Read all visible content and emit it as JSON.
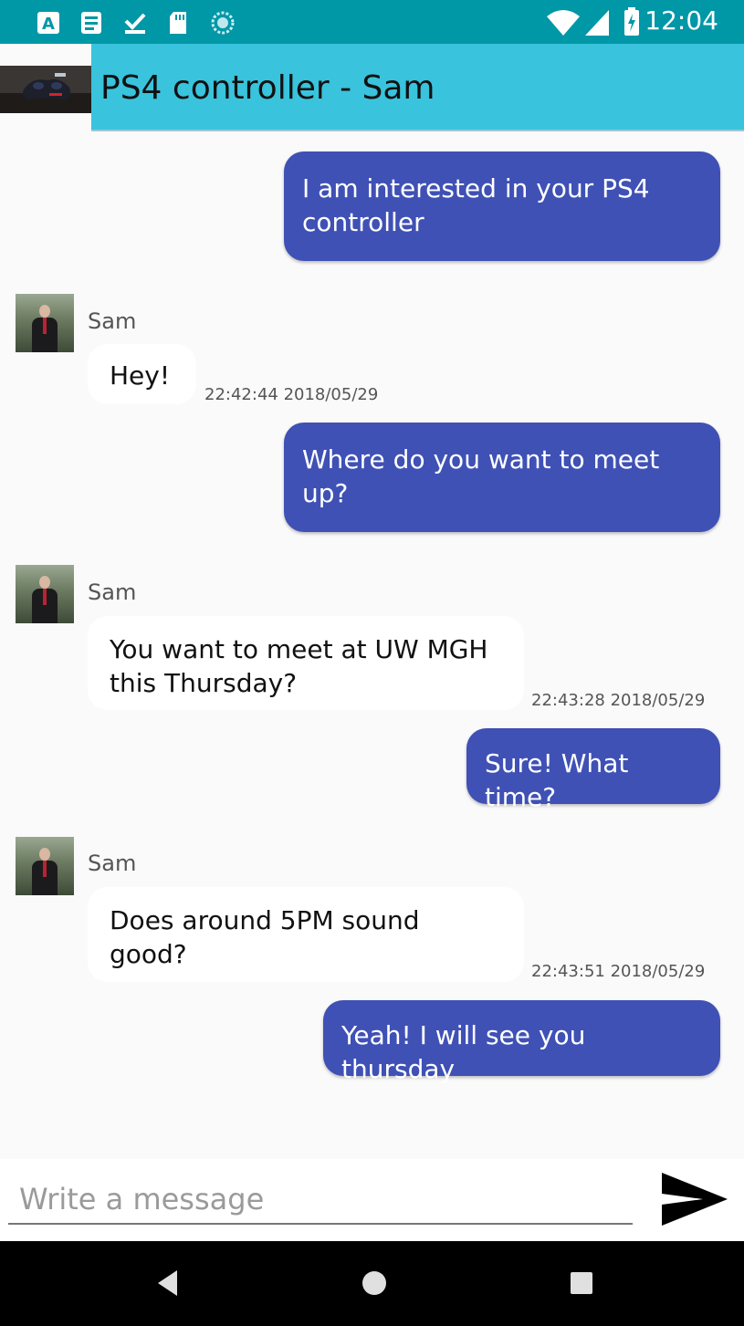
{
  "status_bar": {
    "time": "12:04",
    "left_icons": [
      "a-box-icon",
      "notes-icon",
      "checkmark-download-icon",
      "sd-card-icon",
      "sync-circle-icon"
    ],
    "right_icons": [
      "wifi-icon",
      "signal-icon",
      "battery-charging-icon"
    ]
  },
  "app_bar": {
    "title": "PS4 controller - Sam"
  },
  "messages": [
    {
      "type": "out",
      "text": "I am interested in your PS4 controller"
    },
    {
      "type": "in",
      "sender": "Sam",
      "text": "Hey!",
      "time": "22:42:44 2018/05/29"
    },
    {
      "type": "out",
      "text": "Where do you want to meet up?"
    },
    {
      "type": "in",
      "sender": "Sam",
      "text": "You want to meet at UW MGH this Thursday?",
      "time": "22:43:28 2018/05/29"
    },
    {
      "type": "out",
      "text": "Sure! What time?"
    },
    {
      "type": "in",
      "sender": "Sam",
      "text": "Does around 5PM sound good?",
      "time": "22:43:51 2018/05/29"
    },
    {
      "type": "out",
      "text": "Yeah! I will see you thursday"
    }
  ],
  "composer": {
    "placeholder": "Write a message",
    "value": ""
  },
  "colors": {
    "status_bar": "#0097a7",
    "app_bar": "#39c3dc",
    "outgoing_bubble": "#3f51b5",
    "incoming_bubble": "#ffffff",
    "background": "#fafafa"
  }
}
